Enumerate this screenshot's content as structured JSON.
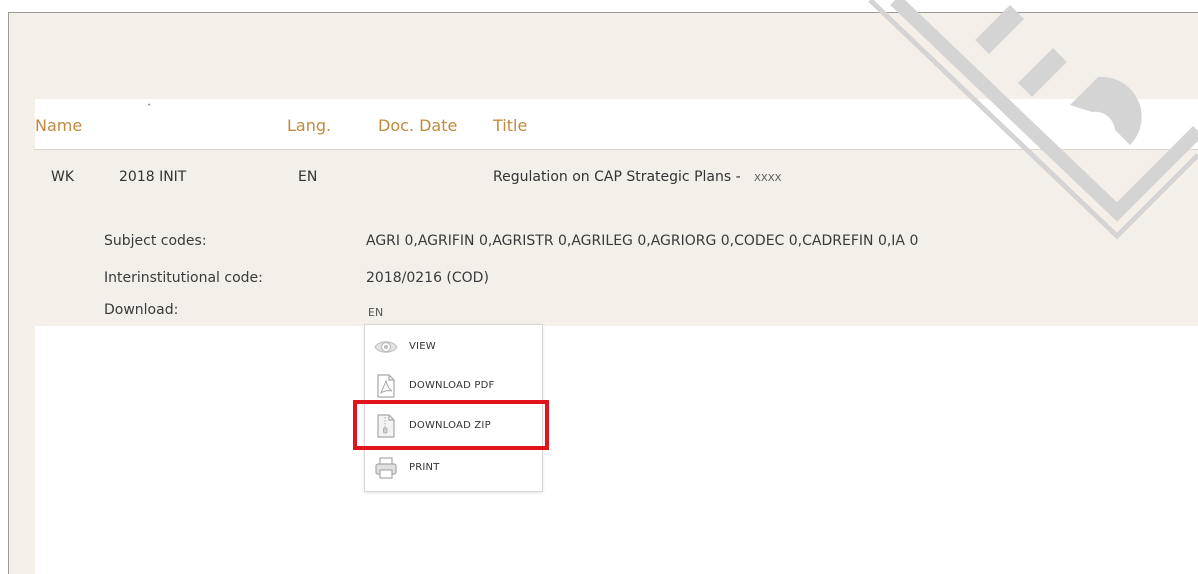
{
  "table": {
    "headers": {
      "name": "Name",
      "lang": "Lang.",
      "doc_date": "Doc. Date",
      "title": "Title"
    },
    "sort_indicator": "ˆ",
    "row": {
      "prefix": "WK",
      "number": "2018 INIT",
      "lang": "EN",
      "doc_date": "",
      "title": "Regulation on CAP Strategic Plans -",
      "title_suffix": "XXXX"
    }
  },
  "details": {
    "subject_codes_label": "Subject codes:",
    "subject_codes_value": "AGRI 0,AGRIFIN 0,AGRISTR 0,AGRILEG 0,AGRIORG 0,CODEC 0,CADREFIN 0,IA 0",
    "interinstitutional_label": "Interinstitutional code:",
    "interinstitutional_value": "2018/0216 (COD)",
    "download_label": "Download:",
    "download_lang": "EN"
  },
  "download_menu": {
    "items": [
      {
        "label": "VIEW",
        "icon": "eye-icon"
      },
      {
        "label": "DOWNLOAD PDF",
        "icon": "pdf-file-icon"
      },
      {
        "label": "DOWNLOAD ZIP",
        "icon": "zip-file-icon"
      },
      {
        "label": "PRINT",
        "icon": "printer-icon"
      }
    ],
    "highlighted_item": "DOWNLOAD ZIP",
    "highlight_color": "#e2141b"
  },
  "colors": {
    "header_text": "#c08a3e",
    "panel_background": "#f5efe9"
  }
}
